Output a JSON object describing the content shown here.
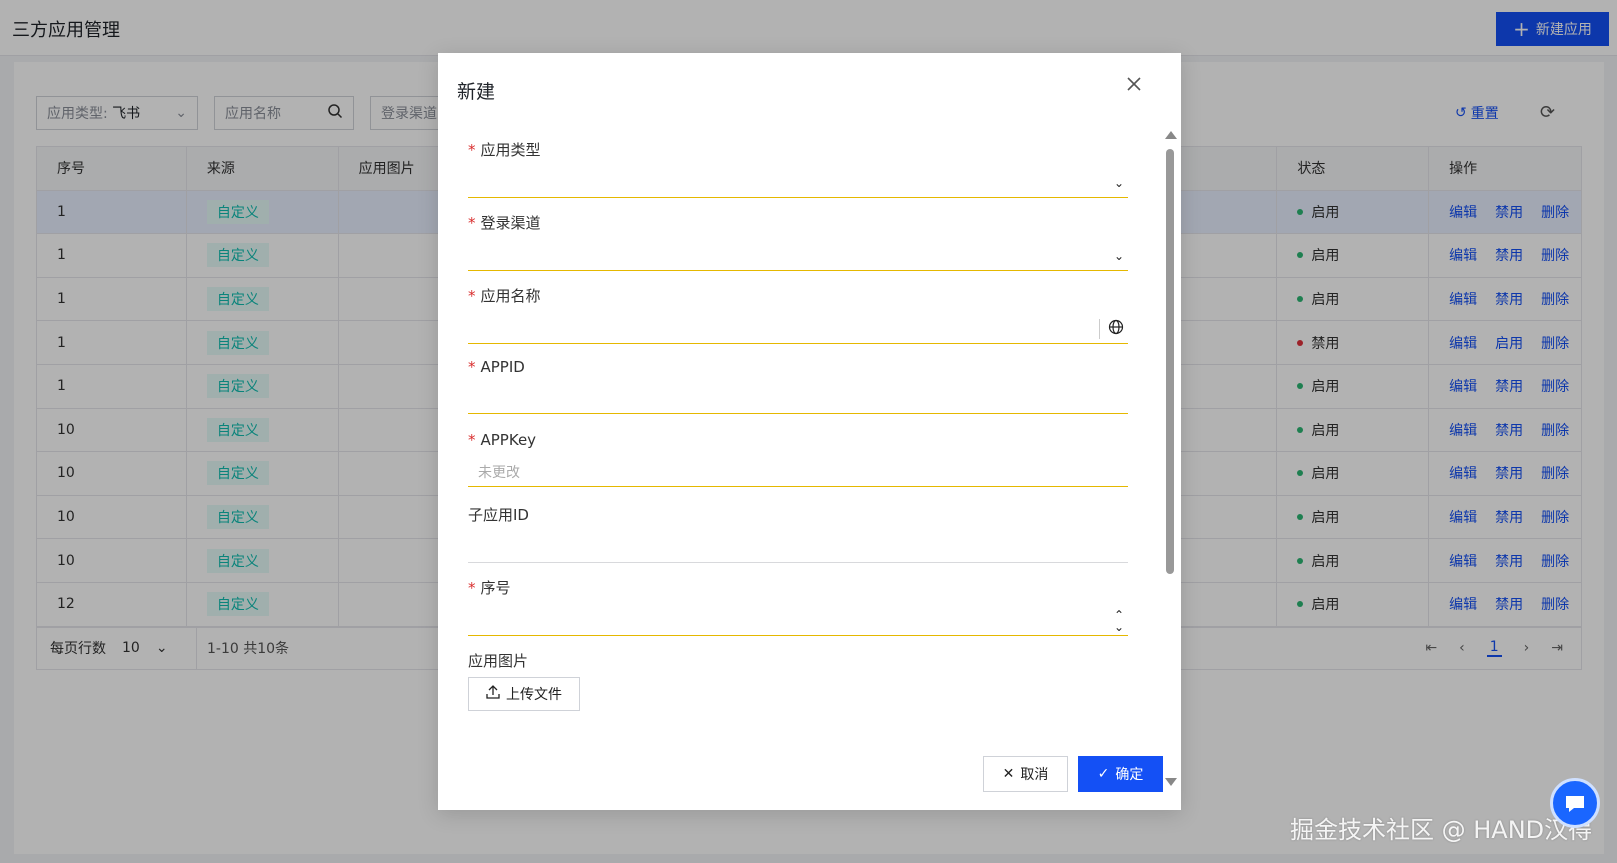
{
  "page": {
    "title": "三方应用管理",
    "new_app_label": "新建应用"
  },
  "filters": {
    "type_label": "应用类型:",
    "type_value": "飞书",
    "name_placeholder": "应用名称",
    "channel_placeholder": "登录渠道",
    "reset_label": "重置"
  },
  "table": {
    "headers": {
      "no": "序号",
      "source": "来源",
      "image": "应用图片",
      "status": "状态",
      "operation": "操作"
    },
    "rows": [
      {
        "no": "1",
        "source": "自定义",
        "status": "启用",
        "toggle": "禁用"
      },
      {
        "no": "1",
        "source": "自定义",
        "status": "启用",
        "toggle": "禁用"
      },
      {
        "no": "1",
        "source": "自定义",
        "status": "启用",
        "toggle": "禁用"
      },
      {
        "no": "1",
        "source": "自定义",
        "status": "禁用",
        "toggle": "启用"
      },
      {
        "no": "1",
        "source": "自定义",
        "status": "启用",
        "toggle": "禁用"
      },
      {
        "no": "10",
        "source": "自定义",
        "status": "启用",
        "toggle": "禁用"
      },
      {
        "no": "10",
        "source": "自定义",
        "status": "启用",
        "toggle": "禁用"
      },
      {
        "no": "10",
        "source": "自定义",
        "status": "启用",
        "toggle": "禁用"
      },
      {
        "no": "10",
        "source": "自定义",
        "status": "启用",
        "toggle": "禁用"
      },
      {
        "no": "12",
        "source": "自定义",
        "status": "启用",
        "toggle": "禁用"
      }
    ],
    "edit_label": "编辑",
    "delete_label": "删除",
    "enabled_color": "#2bb673",
    "disabled_color": "#e0313b"
  },
  "footer": {
    "rows_per_page_label": "每页行数",
    "rows_per_page_value": "10",
    "range_text": "1-10  共10条",
    "current_page": "1"
  },
  "modal": {
    "title": "新建",
    "fields": {
      "app_type": "应用类型",
      "login_channel": "登录渠道",
      "app_name": "应用名称",
      "appid": "APPID",
      "appkey": "APPKey",
      "appkey_placeholder": "未更改",
      "sub_app_id": "子应用ID",
      "seq_no": "序号",
      "app_image": "应用图片"
    },
    "upload_label": "上传文件",
    "cancel_label": "取消",
    "confirm_label": "确定"
  },
  "watermark": "掘金技术社区 @ HAND汉得",
  "colors": {
    "primary": "#1450f5",
    "required": "#d92f2f",
    "focus_underline": "#e5b800"
  }
}
